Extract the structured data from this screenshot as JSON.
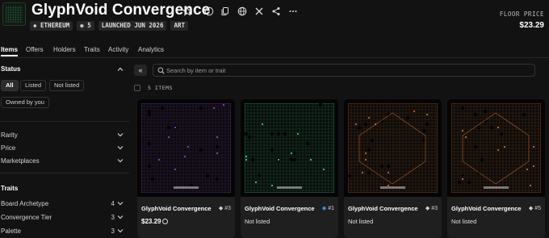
{
  "header": {
    "title": "GlyphVoid Convergence",
    "tags": [
      "ETHEREUM",
      "5",
      "LAUNCHED JUN 2026",
      "ART"
    ],
    "floor_label": "FLOOR PRICE",
    "floor_value": "$23.29"
  },
  "tabs": [
    "Items",
    "Offers",
    "Holders",
    "Traits",
    "Activity",
    "Analytics"
  ],
  "sidebar": {
    "status_title": "Status",
    "status_options": [
      "All",
      "Listed",
      "Not listed",
      "Owned by you"
    ],
    "filters": [
      "Rarity",
      "Price",
      "Marketplaces"
    ],
    "traits_title": "Traits",
    "traits": [
      {
        "label": "Board Archetype",
        "count": "4"
      },
      {
        "label": "Convergence Tier",
        "count": "3"
      },
      {
        "label": "Palette",
        "count": "3"
      }
    ]
  },
  "toolbar": {
    "search_placeholder": "Search by item or trait",
    "item_count": "5 ITEMS"
  },
  "cards": [
    {
      "name": "GlyphVoid Convergence",
      "number": "#3",
      "price": "$23.29",
      "listed": true,
      "accent": "#8a3fd0"
    },
    {
      "name": "GlyphVoid Convergence",
      "number": "#1",
      "price": "Not listed",
      "listed": false,
      "accent": "#2fd07a"
    },
    {
      "name": "GlyphVoid Convergence",
      "number": "#3",
      "price": "Not listed",
      "listed": false,
      "accent": "#c8672a"
    },
    {
      "name": "GlyphVoid Convergence",
      "number": "#5",
      "price": "Not listed",
      "listed": false,
      "accent": "#c86a2a"
    }
  ],
  "icons": [
    "star-icon",
    "info-icon",
    "copy-icon",
    "globe-icon",
    "x-icon",
    "share-icon",
    "more-icon",
    "ethereum-icon",
    "stack-icon",
    "search-icon",
    "collapse-icon",
    "chevron-up-icon",
    "chevron-down-icon"
  ]
}
